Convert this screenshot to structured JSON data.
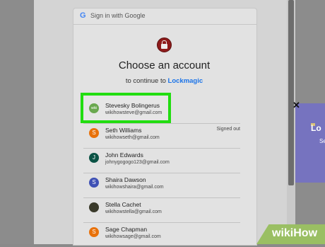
{
  "header": {
    "title": "Sign in with Google"
  },
  "title": "Choose an account",
  "subtitle": {
    "prefix": "to continue to",
    "app": "Lockmagic"
  },
  "accounts": [
    {
      "name": "Stevesky Bolingerus",
      "email": "wikihowsteve@gmail.com",
      "status": "",
      "avatar_letter": "wiki",
      "avatar_color": "#6aa84f"
    },
    {
      "name": "Seth Williams",
      "email": "wikihowseth@gmail.com",
      "status": "Signed out",
      "avatar_letter": "S",
      "avatar_color": "#e8710a"
    },
    {
      "name": "John Edwards",
      "email": "johnygogogo123@gmail.com",
      "status": "",
      "avatar_letter": "J",
      "avatar_color": "#0b5345"
    },
    {
      "name": "Shaira Dawson",
      "email": "wikihowshaira@gmail.com",
      "status": "",
      "avatar_letter": "S",
      "avatar_color": "#3f51b5"
    },
    {
      "name": "Stella Cachet",
      "email": "wikihowstella@gmail.com",
      "status": "",
      "avatar_letter": "",
      "avatar_color": "#3a3a2a"
    },
    {
      "name": "Sage Chapman",
      "email": "wikihowsage@gmail.com",
      "status": "",
      "avatar_letter": "S",
      "avatar_color": "#e8710a"
    }
  ],
  "right_panel": {
    "text1": "Lo",
    "text2": "Se"
  },
  "watermark": "wikiHow",
  "colors": {
    "highlight": "#22dd11",
    "link": "#1a73e8",
    "side_panel": "#7673bf"
  }
}
